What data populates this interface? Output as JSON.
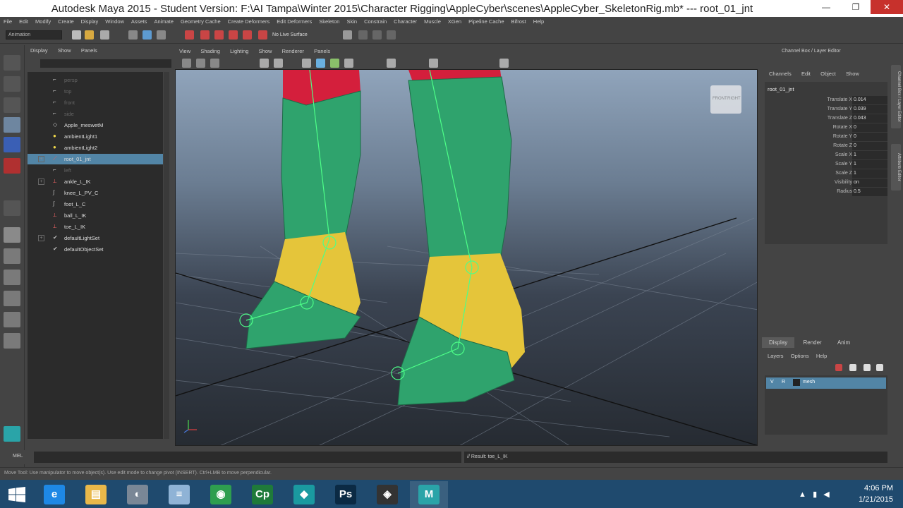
{
  "window": {
    "title": "Autodesk Maya 2015 - Student Version: F:\\AI Tampa\\Winter 2015\\Character Rigging\\AppleCyber\\scenes\\AppleCyber_SkeletonRig.mb*   ---   root_01_jnt",
    "minimize": "—",
    "restore": "❐",
    "close": "✕"
  },
  "menubar": [
    "File",
    "Edit",
    "Modify",
    "Create",
    "Display",
    "Window",
    "Assets",
    "Animate",
    "Geometry Cache",
    "Create Deformers",
    "Edit Deformers",
    "Skeleton",
    "Skin",
    "Constrain",
    "Character",
    "Muscle",
    "XGen",
    "Pipeline Cache",
    "Bifrost",
    "Help"
  ],
  "statusline": {
    "mode": "Animation",
    "no_live_surface": "No Live Surface"
  },
  "outliner": {
    "menu": [
      "Display",
      "Show",
      "Panels"
    ],
    "items": [
      {
        "label": "persp",
        "icon": "camera",
        "dim": true
      },
      {
        "label": "top",
        "icon": "camera",
        "dim": true
      },
      {
        "label": "front",
        "icon": "camera",
        "dim": true
      },
      {
        "label": "side",
        "icon": "camera",
        "dim": true
      },
      {
        "label": "Apple_meswetM",
        "icon": "mesh",
        "dim": false
      },
      {
        "label": "ambientLight1",
        "icon": "light",
        "dim": false
      },
      {
        "label": "ambientLight2",
        "icon": "light",
        "dim": false
      },
      {
        "label": "root_01_jnt",
        "icon": "joint",
        "dim": false,
        "selected": true,
        "expand": "+"
      },
      {
        "label": "left",
        "icon": "camera",
        "dim": true
      },
      {
        "label": "ankle_L_IK",
        "icon": "ik",
        "dim": false,
        "expand": "+"
      },
      {
        "label": "knee_L_PV_C",
        "icon": "curve",
        "dim": false
      },
      {
        "label": "foot_L_C",
        "icon": "curve",
        "dim": false
      },
      {
        "label": "ball_L_IK",
        "icon": "ik",
        "dim": false
      },
      {
        "label": "toe_L_IK",
        "icon": "ik",
        "dim": false
      },
      {
        "label": "defaultLightSet",
        "icon": "set",
        "dim": false,
        "expand": "+"
      },
      {
        "label": "defaultObjectSet",
        "icon": "set",
        "dim": false
      }
    ]
  },
  "viewport": {
    "menu": [
      "View",
      "Shading",
      "Lighting",
      "Show",
      "Renderer",
      "Panels"
    ],
    "viewcube": [
      "FRONT",
      "RIGHT"
    ],
    "colors": {
      "green": "#2fa36d",
      "yellow": "#e5c53a",
      "red": "#d41f3c",
      "joint": "#4dff88"
    }
  },
  "channelbox": {
    "title": "Channel Box / Layer Editor",
    "menu": [
      "Channels",
      "Edit",
      "Object",
      "Show"
    ],
    "object": "root_01_jnt",
    "attributes": [
      {
        "name": "Translate X",
        "value": "0.014"
      },
      {
        "name": "Translate Y",
        "value": "0.039"
      },
      {
        "name": "Translate Z",
        "value": "0.043"
      },
      {
        "name": "Rotate X",
        "value": "0"
      },
      {
        "name": "Rotate Y",
        "value": "0"
      },
      {
        "name": "Rotate Z",
        "value": "0"
      },
      {
        "name": "Scale X",
        "value": "1"
      },
      {
        "name": "Scale Y",
        "value": "1"
      },
      {
        "name": "Scale Z",
        "value": "1"
      },
      {
        "name": "Visibility",
        "value": "on"
      },
      {
        "name": "Radius",
        "value": "0.5"
      }
    ]
  },
  "sidetabs": [
    "Channel Box / Layer Editor",
    "Attribute Editor"
  ],
  "layereditor": {
    "tabs": [
      "Display",
      "Render",
      "Anim"
    ],
    "menu": [
      "Layers",
      "Options",
      "Help"
    ],
    "layer": {
      "v": "V",
      "p": "R",
      "name": "mesh"
    }
  },
  "cmdline": {
    "label": "MEL",
    "result": "// Result: toe_L_IK"
  },
  "helpline": "Move Tool: Use manipulator to move object(s). Use edit mode to change pivot (INSERT). Ctrl+LMB to move perpendicular.",
  "taskbar": {
    "apps": [
      {
        "name": "ie",
        "glyph": "e",
        "color": "#1e88e5"
      },
      {
        "name": "explorer",
        "glyph": "▤",
        "color": "#e8b84a"
      },
      {
        "name": "paint",
        "glyph": "◐",
        "color": "#7a8796"
      },
      {
        "name": "notepad",
        "glyph": "≡",
        "color": "#8fb3d6"
      },
      {
        "name": "chrome",
        "glyph": "◉",
        "color": "#2e9e4f"
      },
      {
        "name": "captivate",
        "glyph": "Cp",
        "color": "#1f7a3a"
      },
      {
        "name": "3dsmax",
        "glyph": "◆",
        "color": "#1a9aa0"
      },
      {
        "name": "photoshop",
        "glyph": "Ps",
        "color": "#0b2a44"
      },
      {
        "name": "unity",
        "glyph": "◈",
        "color": "#333"
      },
      {
        "name": "maya",
        "glyph": "M",
        "color": "#2aa4a8"
      }
    ],
    "time": "4:06 PM",
    "date": "1/21/2015"
  }
}
